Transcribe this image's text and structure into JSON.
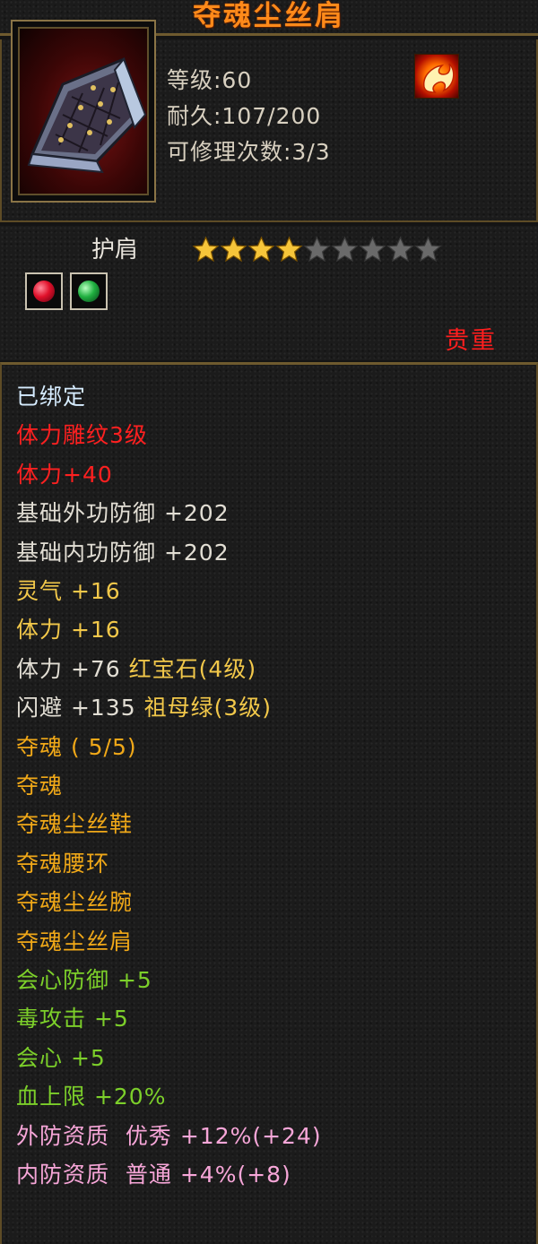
{
  "title": "夺魂尘丝肩",
  "item": {
    "icon": "shoulder-pad-icon",
    "level": "等级:60",
    "durability": "耐久:107/200",
    "repairs": "可修理次数:3/3",
    "class_icon": "flame-class-icon",
    "slot": "护肩",
    "stars_filled": 4,
    "stars_total": 9,
    "gems": [
      {
        "name": "ruby-gem-icon",
        "color": "#e0102a"
      },
      {
        "name": "emerald-gem-icon",
        "color": "#20b040"
      }
    ],
    "rarity": "贵重"
  },
  "colors": {
    "bound": "#d6ecff",
    "red": "#ff2020",
    "white": "#e2ded4",
    "yellow": "#f2c84a",
    "orange": "#f0a818",
    "green": "#7ccf2a",
    "pink": "#f7a6d8",
    "title": "#ff8a1a",
    "star_on": "#f6c53a",
    "star_off": "#6a6a6a"
  },
  "attributes": [
    {
      "text": "已绑定",
      "color": "bound"
    },
    {
      "text": "体力雕纹3级",
      "color": "red"
    },
    {
      "text": "体力+40",
      "color": "red"
    },
    {
      "text": "基础外功防御 +202",
      "color": "white"
    },
    {
      "text": "基础内功防御 +202",
      "color": "white"
    },
    {
      "text": "灵气 +16",
      "color": "yellow"
    },
    {
      "text": "体力 +16",
      "color": "yellow"
    },
    {
      "text": "体力 +76 红宝石(4级)",
      "color": "white",
      "gem": true,
      "stat": "体力 +76",
      "gem_text": "红宝石(4级)"
    },
    {
      "text": "闪避 +135 祖母绿(3级)",
      "color": "white",
      "gem": true,
      "stat": "闪避 +135",
      "gem_text": "祖母绿(3级)"
    },
    {
      "text": "夺魂 ( 5/5)",
      "color": "orange"
    },
    {
      "text": "夺魂",
      "color": "orange"
    },
    {
      "text": "夺魂尘丝鞋",
      "color": "orange"
    },
    {
      "text": "夺魂腰环",
      "color": "orange"
    },
    {
      "text": "夺魂尘丝腕",
      "color": "orange"
    },
    {
      "text": "夺魂尘丝肩",
      "color": "orange"
    },
    {
      "text": "会心防御 +5",
      "color": "green"
    },
    {
      "text": "毒攻击 +5",
      "color": "green"
    },
    {
      "text": "会心 +5",
      "color": "green"
    },
    {
      "text": "血上限 +20%",
      "color": "green"
    },
    {
      "text": "外防资质  优秀 +12%(+24)",
      "color": "pink"
    },
    {
      "text": "内防资质  普通 +4%(+8)",
      "color": "pink"
    }
  ]
}
